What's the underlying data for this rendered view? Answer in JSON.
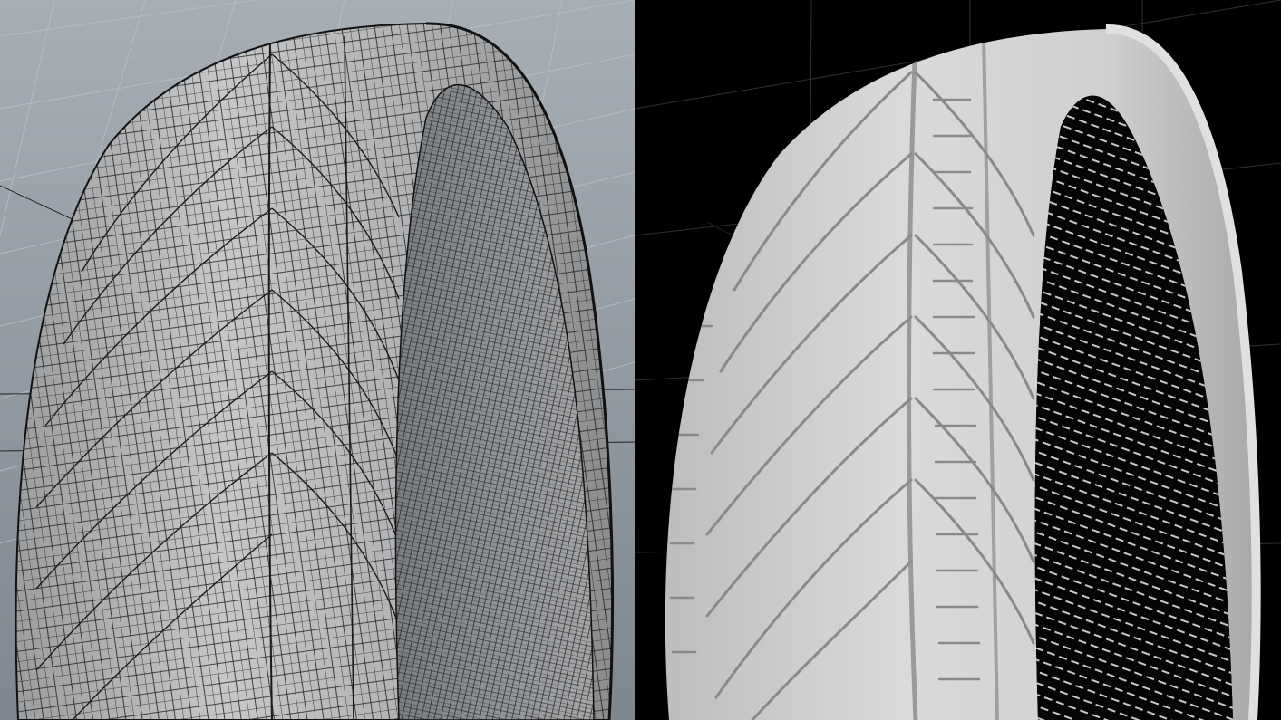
{
  "panels": [
    {
      "id": "wireframe",
      "mode": "wireframe-shaded",
      "background": "#9aa2ab",
      "mesh_color": "#b9bbbe",
      "edge_color": "#1a1a1a"
    },
    {
      "id": "render",
      "mode": "rendered",
      "background": "#000000",
      "surface_color": "#d3d3d3",
      "groove_color": "#7d7d7d"
    }
  ],
  "colors": {
    "viewport_grid_light": "#b2bac3",
    "viewport_grid_dark": "#848c95",
    "render_grid": "#3a3a3a"
  },
  "icons": [
    "tire-wireframe-icon",
    "tire-render-icon"
  ]
}
